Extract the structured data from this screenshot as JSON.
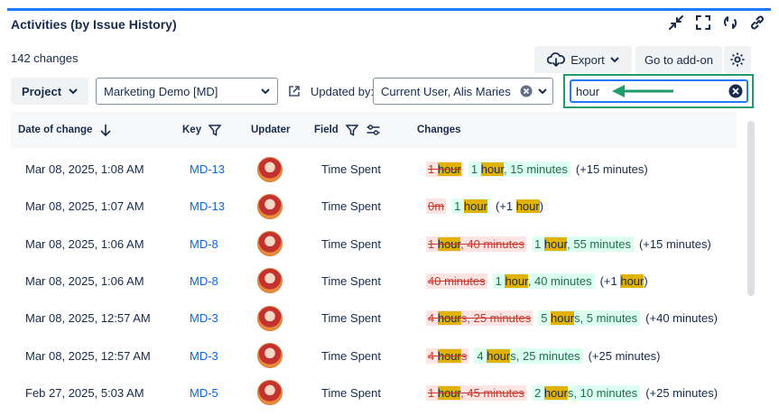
{
  "panel": {
    "title": "Activities (by Issue History)",
    "changes_count": "142 changes",
    "icons": [
      "collapse-icon",
      "expand-icon",
      "refresh-icon",
      "link-icon"
    ]
  },
  "toolbar": {
    "export_label": "Export",
    "addon_label": "Go to add-on"
  },
  "filters": {
    "project_label": "Project",
    "project_value": "Marketing Demo [MD]",
    "updated_by_label": "Updated by:",
    "updated_by_value": "Current User, Alis Maries",
    "search_value": "hour"
  },
  "table": {
    "headers": {
      "date": "Date of change",
      "key": "Key",
      "updater": "Updater",
      "field": "Field",
      "changes": "Changes"
    },
    "rows": [
      {
        "date": "Mar 08, 2025, 1:08 AM",
        "key": "MD-13",
        "field": "Time Spent",
        "old": [
          {
            "t": "1 "
          },
          {
            "t": "hour",
            "h": true
          }
        ],
        "new": [
          {
            "t": "1 "
          },
          {
            "t": "hour",
            "h": true
          },
          {
            "t": ", 15 minutes"
          }
        ],
        "delta": [
          {
            "t": "(+15 minutes)"
          }
        ]
      },
      {
        "date": "Mar 08, 2025, 1:07 AM",
        "key": "MD-13",
        "field": "Time Spent",
        "old": [
          {
            "t": "0m"
          }
        ],
        "new": [
          {
            "t": "1 "
          },
          {
            "t": "hour",
            "h": true
          }
        ],
        "delta": [
          {
            "t": "(+1 "
          },
          {
            "t": "hour",
            "h": true
          },
          {
            "t": ")"
          }
        ]
      },
      {
        "date": "Mar 08, 2025, 1:06 AM",
        "key": "MD-8",
        "field": "Time Spent",
        "old": [
          {
            "t": "1 "
          },
          {
            "t": "hour",
            "h": true
          },
          {
            "t": ", 40 minutes"
          }
        ],
        "new": [
          {
            "t": "1 "
          },
          {
            "t": "hour",
            "h": true
          },
          {
            "t": ", 55 minutes"
          }
        ],
        "delta": [
          {
            "t": "(+15 minutes)"
          }
        ]
      },
      {
        "date": "Mar 08, 2025, 1:06 AM",
        "key": "MD-8",
        "field": "Time Spent",
        "old": [
          {
            "t": "40 minutes"
          }
        ],
        "new": [
          {
            "t": "1 "
          },
          {
            "t": "hour",
            "h": true
          },
          {
            "t": ", 40 minutes"
          }
        ],
        "delta": [
          {
            "t": "(+1 "
          },
          {
            "t": "hour",
            "h": true
          },
          {
            "t": ")"
          }
        ]
      },
      {
        "date": "Mar 08, 2025, 12:57 AM",
        "key": "MD-3",
        "field": "Time Spent",
        "old": [
          {
            "t": "4 "
          },
          {
            "t": "hour",
            "h": true
          },
          {
            "t": "s, 25 minutes"
          }
        ],
        "new": [
          {
            "t": "5 "
          },
          {
            "t": "hour",
            "h": true
          },
          {
            "t": "s, 5 minutes"
          }
        ],
        "delta": [
          {
            "t": "(+40 minutes)"
          }
        ]
      },
      {
        "date": "Mar 08, 2025, 12:57 AM",
        "key": "MD-3",
        "field": "Time Spent",
        "old": [
          {
            "t": "4 "
          },
          {
            "t": "hour",
            "h": true
          },
          {
            "t": "s"
          }
        ],
        "new": [
          {
            "t": "4 "
          },
          {
            "t": "hour",
            "h": true
          },
          {
            "t": "s, 25 minutes"
          }
        ],
        "delta": [
          {
            "t": "(+25 minutes)"
          }
        ]
      },
      {
        "date": "Feb 27, 2025, 5:03 AM",
        "key": "MD-5",
        "field": "Time Spent",
        "old": [
          {
            "t": "1 "
          },
          {
            "t": "hour",
            "h": true
          },
          {
            "t": ", 45 minutes"
          }
        ],
        "new": [
          {
            "t": "2 "
          },
          {
            "t": "hour",
            "h": true
          },
          {
            "t": "s, 10 minutes"
          }
        ],
        "delta": [
          {
            "t": "(+25 minutes)"
          }
        ]
      }
    ]
  }
}
